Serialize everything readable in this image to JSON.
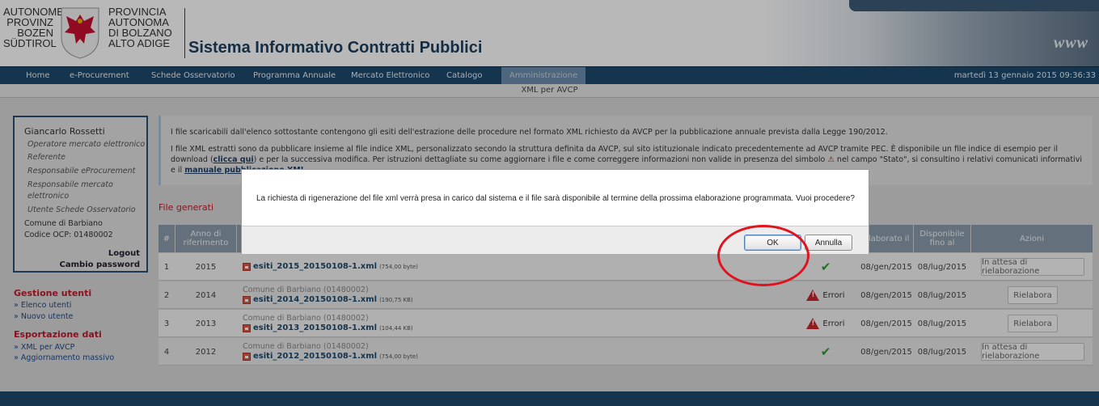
{
  "header": {
    "logo_left": [
      "AUTONOME",
      "PROVINZ",
      "BOZEN",
      "SÜDTIROL"
    ],
    "logo_right": [
      "PROVINCIA",
      "AUTONOMA",
      "DI BOLZANO",
      "ALTO ADIGE"
    ],
    "title": "Sistema Informativo Contratti Pubblici",
    "banner_text": "www"
  },
  "nav": {
    "items": [
      "Home",
      "e-Procurement",
      "Schede Osservatorio",
      "Programma Annuale",
      "Mercato Elettronico",
      "Catalogo",
      "Amministrazione"
    ],
    "active": "Amministrazione",
    "date": "martedì 13 gennaio 2015 09:36:33"
  },
  "subbar": {
    "title": "XML per AVCP"
  },
  "sidebar": {
    "user_name": "Giancarlo Rossetti",
    "roles": [
      "Operatore mercato elettronico",
      "Referente",
      "Responsabile eProcurement",
      "Responsabile mercato",
      "elettronico",
      "Utente Schede Osservatorio"
    ],
    "org": "Comune di Barbiano",
    "ocp_code": "Codice OCP: 01480002",
    "logout": "Logout",
    "change_password": "Cambio password",
    "sections": [
      {
        "title": "Gestione utenti",
        "items": [
          "» Elenco utenti",
          "» Nuovo utente"
        ]
      },
      {
        "title": "Esportazione dati",
        "items": [
          "» XML per AVCP",
          "» Aggiornamento massivo"
        ]
      }
    ]
  },
  "info": {
    "p1": "I file scaricabili dall'elenco sottostante contengono gli esiti dell'estrazione delle procedure nel formato XML richiesto da AVCP per la pubblicazione annuale prevista dalla Legge 190/2012.",
    "p2_a": "I file XML estratti sono da pubblicare insieme al file indice XML, personalizzato secondo la struttura definita da AVCP, sul sito istituzionale indicato precedentemente ad AVCP tramite PEC. È disponibile un file indice di esempio per il download (",
    "p2_link1": "clicca qui",
    "p2_b": ") e per la successiva modifica. Per istruzioni dettagliate su come aggiornare i file e come correggere informazioni non valide in presenza del simbolo",
    "p2_c": "nel campo \"Stato\", si consultino i relativi comunicati informativi e il",
    "p2_link2": "manuale pubblicazione XML",
    "p2_d": "."
  },
  "section_title": "File generati",
  "table": {
    "headers": [
      "#",
      "Anno di riferimento",
      "",
      "",
      "Elaborato il",
      "Disponibile fino al",
      "Azioni"
    ],
    "rows": [
      {
        "num": "1",
        "year": "2015",
        "org": "",
        "file": "esiti_2015_20150108-1.xml",
        "size": "(754,00 byte)",
        "status": "ok",
        "status_label": "",
        "elab": "08/gen/2015",
        "until": "08/lug/2015",
        "action": "In attesa di rielaborazione"
      },
      {
        "num": "2",
        "year": "2014",
        "org": "Comune di Barbiano (01480002)",
        "file": "esiti_2014_20150108-1.xml",
        "size": "(190,75 KB)",
        "status": "error",
        "status_label": "Errori",
        "elab": "08/gen/2015",
        "until": "08/lug/2015",
        "action": "Rielabora"
      },
      {
        "num": "3",
        "year": "2013",
        "org": "Comune di Barbiano (01480002)",
        "file": "esiti_2013_20150108-1.xml",
        "size": "(104,44 KB)",
        "status": "error",
        "status_label": "Errori",
        "elab": "08/gen/2015",
        "until": "08/lug/2015",
        "action": "Rielabora"
      },
      {
        "num": "4",
        "year": "2012",
        "org": "Comune di Barbiano (01480002)",
        "file": "esiti_2012_20150108-1.xml",
        "size": "(754,00 byte)",
        "status": "ok",
        "status_label": "",
        "elab": "08/gen/2015",
        "until": "08/lug/2015",
        "action": "In attesa di rielaborazione"
      }
    ]
  },
  "dialog": {
    "message": "La richiesta di rigenerazione del file xml verrà presa in carico dal sistema e il file sarà disponibile al termine della prossima elaborazione programmata. Vuoi procedere?",
    "ok": "OK",
    "cancel": "Annulla"
  },
  "colors": {
    "nav": "#1e4a6e",
    "accent_red": "#c0192b",
    "highlight_circle": "#e0131f"
  }
}
